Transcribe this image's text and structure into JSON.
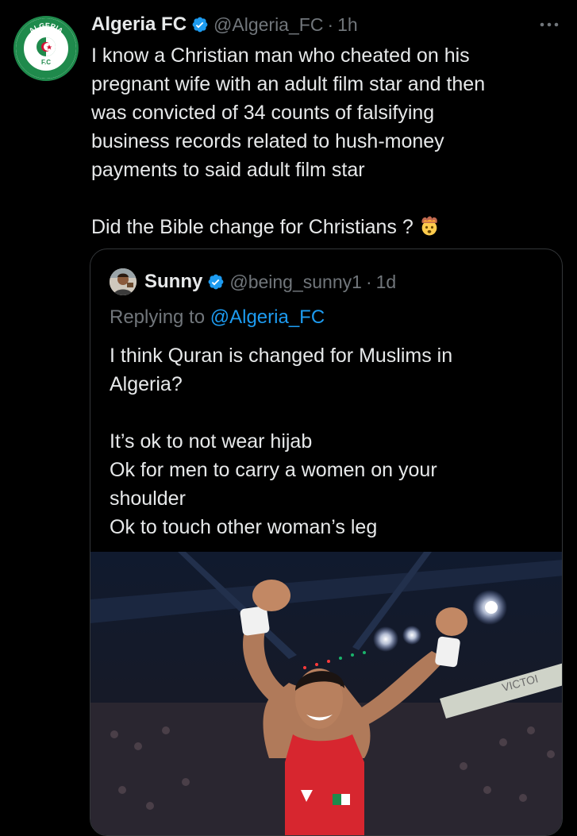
{
  "tweet": {
    "author_name": "Algeria FC",
    "handle": "@Algeria_FC",
    "separator": "·",
    "time": "1h",
    "avatar_text": "ALGERIA",
    "avatar_sub": "F.C",
    "lines": [
      "I know a Christian man who cheated on his",
      "pregnant wife with an adult film star and then",
      "was convicted of 34 counts of falsifying",
      "business records related to hush-money",
      "payments to said adult film star"
    ],
    "question": "Did the Bible change for Christians ?",
    "question_emoji": "exploding-head-icon"
  },
  "quote": {
    "author_name": "Sunny",
    "handle": "@being_sunny1",
    "separator": "·",
    "time": "1d",
    "replying_prefix": "Replying to",
    "replying_mention": "@Algeria_FC",
    "lines_a": [
      "I think Quran is changed for Muslims in",
      "Algeria?"
    ],
    "lines_b": [
      "It’s ok to not wear hijab",
      "Ok for men to carry a women on your",
      "shoulder",
      "Ok to touch other woman’s leg"
    ],
    "image_text": "VICTOI"
  },
  "colors": {
    "background": "#000000",
    "text": "#e7e9ea",
    "muted": "#71767b",
    "link": "#1d9bf0",
    "border": "#333639",
    "brand_green": "#1f8a4c"
  }
}
